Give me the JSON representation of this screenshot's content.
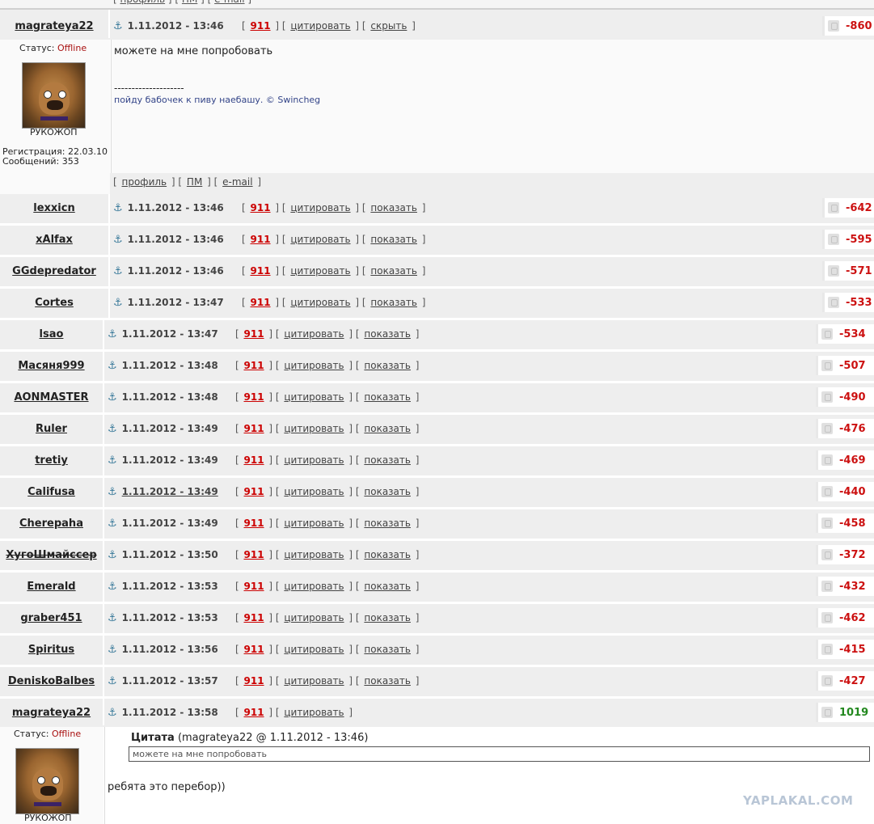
{
  "top_links": {
    "profile": "профиль",
    "pm": "ПМ",
    "email": "e-mail"
  },
  "labels": {
    "n911": "911",
    "quote": "цитировать",
    "hide": "скрыть",
    "show": "показать",
    "status": "Статус:",
    "offline": "Offline",
    "reg_label": "Регистрация:",
    "msgs_label": "Сообщений:"
  },
  "post1": {
    "user": "magrateya22",
    "time": "1.11.2012 - 13:46",
    "rating": "-860",
    "rank": "РУКОЖОП",
    "registered": "22.03.10",
    "messages": "353",
    "text": "можете на мне попробовать",
    "dashes": "--------------------",
    "signature": "пойду бабочек к пиву наебашу. © Swincheg"
  },
  "rows_a": [
    {
      "user": "lexxicn",
      "time": "1.11.2012 - 13:46",
      "rating": "-642"
    },
    {
      "user": "xAlfax",
      "time": "1.11.2012 - 13:46",
      "rating": "-595"
    },
    {
      "user": "GGdepredator",
      "time": "1.11.2012 - 13:46",
      "rating": "-571"
    },
    {
      "user": "Cortes",
      "time": "1.11.2012 - 13:47",
      "rating": "-533"
    }
  ],
  "rows_b": [
    {
      "user": "lsao",
      "time": "1.11.2012 - 13:47",
      "rating": "-534"
    },
    {
      "user": "Масяня999",
      "time": "1.11.2012 - 13:48",
      "rating": "-507"
    },
    {
      "user": "AONMASTER",
      "time": "1.11.2012 - 13:48",
      "rating": "-490"
    },
    {
      "user": "Ruler",
      "time": "1.11.2012 - 13:49",
      "rating": "-476"
    },
    {
      "user": "tretiy",
      "time": "1.11.2012 - 13:49",
      "rating": "-469"
    },
    {
      "user": "Califusa",
      "time": "1.11.2012 - 13:49",
      "rating": "-440"
    },
    {
      "user": "Cherepaha",
      "time": "1.11.2012 - 13:49",
      "rating": "-458"
    },
    {
      "user": "ХугоШмайссер",
      "time": "1.11.2012 - 13:50",
      "rating": "-372"
    },
    {
      "user": "Emerald",
      "time": "1.11.2012 - 13:53",
      "rating": "-432"
    },
    {
      "user": "graber451",
      "time": "1.11.2012 - 13:53",
      "rating": "-462"
    },
    {
      "user": "Spiritus",
      "time": "1.11.2012 - 13:56",
      "rating": "-415"
    },
    {
      "user": "DeniskoBalbes",
      "time": "1.11.2012 - 13:57",
      "rating": "-427"
    }
  ],
  "post2": {
    "user": "magrateya22",
    "time": "1.11.2012 - 13:58",
    "rating": "1019",
    "rank": "РУКОЖОП",
    "quote_label": "Цитата",
    "quote_source": "(magrateya22 @ 1.11.2012 - 13:46)",
    "quote_text": "можете на мне попробовать",
    "text": "ребята это перебор))"
  },
  "watermark": "YAPLAKAL.COM"
}
